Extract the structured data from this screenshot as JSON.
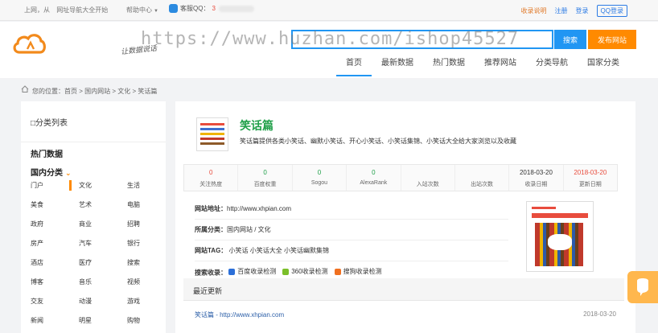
{
  "topbar": {
    "left_text": [
      "上网，从",
      "网址导航大全开始"
    ],
    "help": "帮助中心",
    "qq_label": "客服QQ：",
    "qq_number": "3",
    "links": [
      "收录说明",
      "注册",
      "登录",
      "QQ登录"
    ]
  },
  "header": {
    "slogan": "让数据说话",
    "search_placeholder": "",
    "search_button": "搜索",
    "publish_button": "发布网站",
    "nav": [
      "首页",
      "最新数据",
      "热门数据",
      "推荐网站",
      "分类导航",
      "国家分类"
    ],
    "nav_active_index": 0,
    "watermark": "https://www.huzhan.com/ishop45527"
  },
  "breadcrumb": "您的位置：首页 > 国内网站 > 文化 > 笑话篇",
  "sidebar": {
    "title": "□分类列表",
    "hot": "热门数据",
    "domestic": "国内分类",
    "categories": [
      "门户",
      "文化",
      "生活",
      "美食",
      "艺术",
      "电脑",
      "政府",
      "商业",
      "招聘",
      "房产",
      "汽车",
      "银行",
      "酒店",
      "医疗",
      "搜索",
      "博客",
      "音乐",
      "视频",
      "交友",
      "动漫",
      "游戏",
      "新闻",
      "明星",
      "购物"
    ]
  },
  "site": {
    "title": "笑话篇",
    "description": "笑话篇提供各类小笑话、幽默小笑话、开心小笑话、小笑话集锦、小笑话大全给大家浏览以及收藏",
    "stats": [
      {
        "value": "0",
        "label": "关注热度",
        "color": "#e84c3d"
      },
      {
        "value": "0",
        "label": "百度权重",
        "color": "#21a04a"
      },
      {
        "value": "0",
        "label": "Sogou",
        "color": "#21a04a"
      },
      {
        "value": "0",
        "label": "AlexaRank",
        "color": "#21a04a"
      },
      {
        "value": "",
        "label": "入站次数",
        "color": "#333333"
      },
      {
        "value": "",
        "label": "出站次数",
        "color": "#333333"
      },
      {
        "value": "2018-03-20",
        "label": "收录日期",
        "color": "#333333"
      },
      {
        "value": "2018-03-20",
        "label": "更新日期",
        "color": "#e84c3d"
      }
    ],
    "url_label": "网站地址：",
    "url": "http://www.xhpian.com",
    "category_label": "所属分类：",
    "category": "国内网站 / 文化",
    "tags_label": "网站TAG：",
    "tags": [
      "小笑话",
      "小笑话大全",
      "小笑话幽默集锦"
    ],
    "check_label": "搜索收录：",
    "checks": [
      {
        "label": "百度收录检测",
        "color": "#2c6fd8"
      },
      {
        "label": "360收录检测",
        "color": "#7bbf2a"
      },
      {
        "label": "搜狗收录检测",
        "color": "#f07020"
      }
    ]
  },
  "recent": {
    "heading": "最近更新",
    "item": "笑话篇 - http://www.xhpian.com",
    "date": "2018-03-20"
  }
}
